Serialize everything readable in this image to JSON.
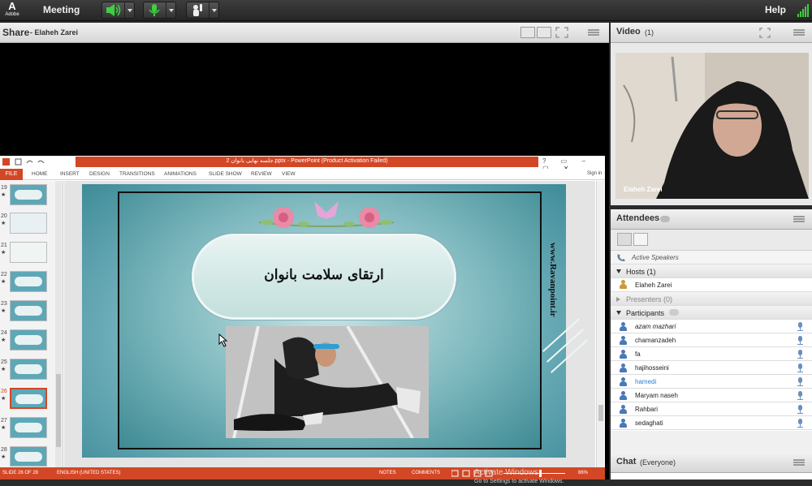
{
  "topbar": {
    "brand_symbol": "A",
    "brand_text": "Adobe",
    "menu_meeting": "Meeting",
    "menu_help": "Help"
  },
  "share": {
    "title": "Share",
    "presenter": "- Elaheh Zarei"
  },
  "powerpoint": {
    "window_title": "جلسه نهایی بانوان 2.pptx - PowerPoint (Product Activation Failed)",
    "window_buttons": "? ▭ – ▢ ✕",
    "tab_file": "FILE",
    "tabs": [
      "HOME",
      "INSERT",
      "DESIGN",
      "TRANSITIONS",
      "ANIMATIONS",
      "SLIDE SHOW",
      "REVIEW",
      "VIEW"
    ],
    "sign_in": "Sign in",
    "thumbnails": [
      {
        "num": "19",
        "star": "★"
      },
      {
        "num": "20",
        "star": "★"
      },
      {
        "num": "21",
        "star": "★"
      },
      {
        "num": "22",
        "star": "★"
      },
      {
        "num": "23",
        "star": "★"
      },
      {
        "num": "24",
        "star": "★"
      },
      {
        "num": "25",
        "star": "★"
      },
      {
        "num": "26",
        "star": "★"
      },
      {
        "num": "27",
        "star": "★"
      },
      {
        "num": "28",
        "star": "★"
      }
    ],
    "selected_slide": "26",
    "slide_title": "ارتقای سلامت بانوان",
    "slide_watermark": "www.Ravanpoint.ir",
    "status_slide": "SLIDE 26 OF 28",
    "status_language": "ENGLISH (UNITED STATES)",
    "status_notes": "NOTES",
    "status_comments": "COMMENTS",
    "zoom": "86%",
    "activate_title": "Activate Windows",
    "activate_sub": "Go to Settings to activate Windows."
  },
  "video": {
    "title": "Video",
    "count": "(1)",
    "name": "Elaheh Zarei"
  },
  "attendees": {
    "title": "Attendees",
    "active_speakers": "Active Speakers",
    "hosts_label": "Hosts (1)",
    "hosts": [
      "Elaheh Zarei"
    ],
    "presenters_label": "Presenters (0)",
    "participants_label": "Participants",
    "participants": [
      {
        "name": "azam mazhari",
        "style": "italic"
      },
      {
        "name": "chamanzadeh",
        "style": "normal"
      },
      {
        "name": "fa",
        "style": "normal"
      },
      {
        "name": "hajihosseini",
        "style": "normal"
      },
      {
        "name": "hamedi",
        "style": "link"
      },
      {
        "name": "Maryam naseh",
        "style": "normal"
      },
      {
        "name": "Rahbari",
        "style": "normal"
      },
      {
        "name": "sedaghati",
        "style": "normal"
      }
    ]
  },
  "chat": {
    "title": "Chat",
    "scope": "(Everyone)"
  },
  "colors": {
    "ppt_accent": "#d24726",
    "speaker_green": "#3fcf3f",
    "user_blue": "#4a78b8"
  }
}
